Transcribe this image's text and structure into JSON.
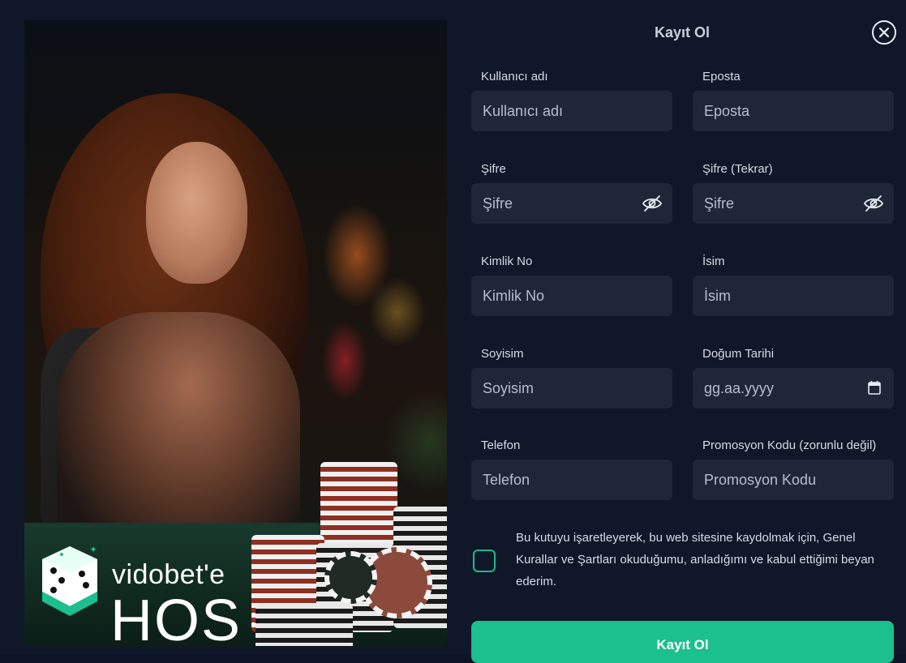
{
  "modal": {
    "title": "Kayıt Ol",
    "close_icon": "close-icon"
  },
  "promo": {
    "brand_line1": "vidobet'e",
    "brand_line2": "HOS",
    "image_icon": "dice-logo-icon"
  },
  "form": {
    "fields": [
      {
        "label": "Kullanıcı adı",
        "placeholder": "Kullanıcı adı"
      },
      {
        "label": "Eposta",
        "placeholder": "Eposta"
      },
      {
        "label": "Şifre",
        "placeholder": "Şifre",
        "icon": "eye-off-icon"
      },
      {
        "label": "Şifre (Tekrar)",
        "placeholder": "Şifre",
        "icon": "eye-off-icon"
      },
      {
        "label": "Kimlik No",
        "placeholder": "Kimlik No"
      },
      {
        "label": "İsim",
        "placeholder": "İsim"
      },
      {
        "label": "Soyisim",
        "placeholder": "Soyisim"
      },
      {
        "label": "Doğum Tarihi",
        "placeholder": "gg.aa.yyyy",
        "icon": "calendar-icon"
      },
      {
        "label": "Telefon",
        "placeholder": "Telefon"
      },
      {
        "label": "Promosyon Kodu (zorunlu değil)",
        "placeholder": "Promosyon Kodu"
      }
    ],
    "consent_text": "Bu kutuyu işaretleyerek, bu web sitesine kaydolmak için, Genel Kurallar ve Şartları okuduğumu, anladığımı ve kabul ettiğimi beyan ederim.",
    "consent_checked": false,
    "submit_label": "Kayıt Ol"
  },
  "colors": {
    "background": "#0f1729",
    "input_bg": "#1e2638",
    "accent": "#1cbf8e"
  }
}
